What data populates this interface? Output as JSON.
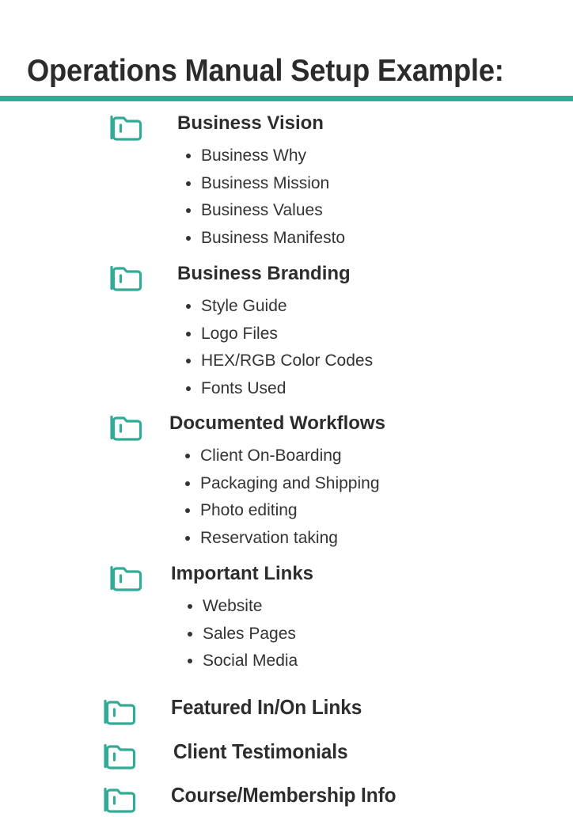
{
  "page": {
    "title": "Operations Manual Setup Example:",
    "accent_color": "#31ab95",
    "text_color": "#2d2d2d",
    "background_color": "#ffffff"
  },
  "divider": {
    "color": "#31ab95"
  },
  "sections": [
    {
      "icon": "folder-icon",
      "title": "Business Vision",
      "title_style": "regular",
      "items": [
        "Business Why",
        "Business Mission",
        "Business Values",
        "Business Manifesto"
      ]
    },
    {
      "icon": "folder-icon",
      "title": "Business Branding",
      "title_style": "regular",
      "items": [
        "Style Guide",
        "Logo Files",
        "HEX/RGB Color Codes",
        "Fonts Used"
      ]
    },
    {
      "icon": "folder-icon",
      "title": "Documented Workflows",
      "title_style": "regular",
      "items": [
        "Client On-Boarding",
        "Packaging and Shipping",
        "Photo editing",
        "Reservation taking"
      ]
    },
    {
      "icon": "folder-icon",
      "title": "Important Links",
      "title_style": "regular",
      "items": [
        "Website",
        "Sales Pages",
        "Social Media"
      ]
    },
    {
      "icon": "folder-icon",
      "title": "Featured In/On Links",
      "title_style": "narrow",
      "items": []
    },
    {
      "icon": "folder-icon",
      "title": "Client Testimonials",
      "title_style": "narrow",
      "items": []
    },
    {
      "icon": "folder-icon",
      "title": "Course/Membership Info",
      "title_style": "narrow",
      "items": []
    }
  ]
}
